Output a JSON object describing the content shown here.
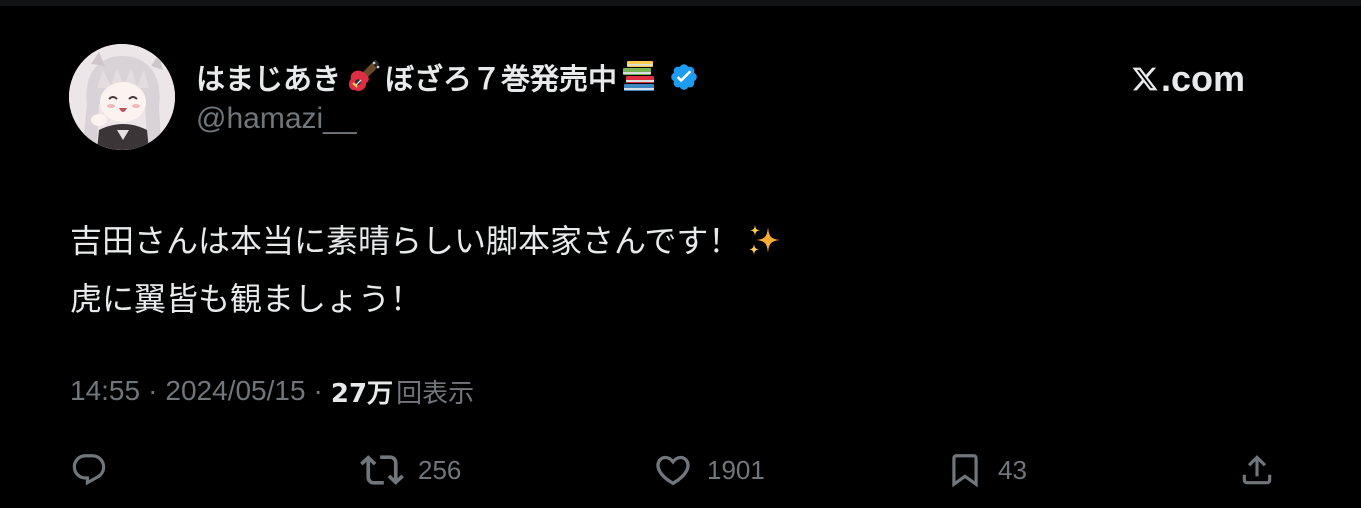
{
  "tweet": {
    "display_name": "はまじあき",
    "display_name_mid": "ぼざろ７巻発売中",
    "handle": "@hamazi__",
    "body_lines": [
      "吉田さんは本当に素晴らしい脚本家さんです！",
      "虎に翼皆も観ましょう！"
    ],
    "time": "14:55",
    "separator": "·",
    "date": "2024/05/15",
    "views_count": "27万",
    "views_label": "回表示"
  },
  "site": {
    "domain": ".com"
  },
  "actions": {
    "reply": {
      "icon": "reply-icon",
      "count": ""
    },
    "retweet": {
      "icon": "retweet-icon",
      "count": "256"
    },
    "like": {
      "icon": "heart-icon",
      "count": "1901"
    },
    "bookmark": {
      "icon": "bookmark-icon",
      "count": "43"
    },
    "share": {
      "icon": "share-icon",
      "count": ""
    }
  },
  "icons": {
    "verified": "verified-badge-icon",
    "guitar": "guitar-emoji-icon",
    "books": "books-emoji-icon",
    "sparkles": "sparkles-emoji-icon",
    "x_logo": "x-logo-icon"
  },
  "colors": {
    "background": "#000000",
    "primary_text": "#e7e9ea",
    "secondary_text": "#71767b",
    "verified_blue": "#1d9bf0"
  }
}
